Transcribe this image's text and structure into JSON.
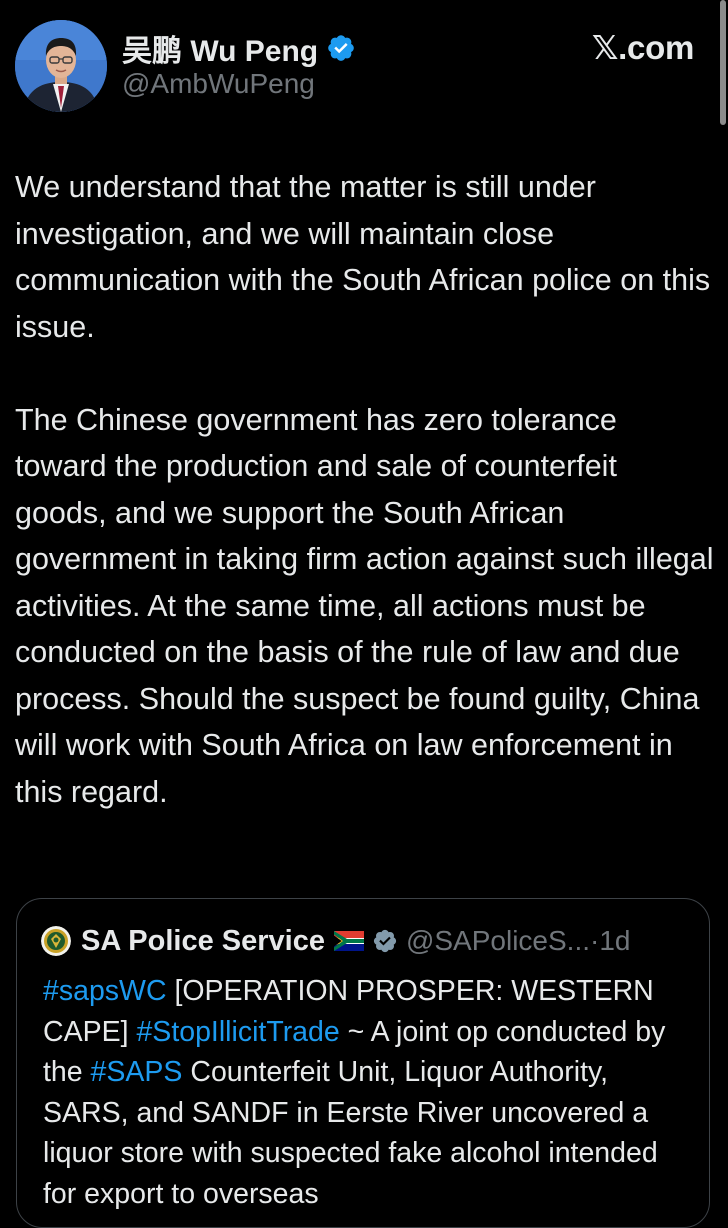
{
  "author": {
    "name": "吴鹏 Wu Peng",
    "handle": "@AmbWuPeng",
    "verified_color": "#1d9bf0"
  },
  "site_label": "𝕏.com",
  "icons": {
    "avatar": "profile-photo",
    "verified": "verified-badge-icon",
    "flag": "south-africa-flag-icon"
  },
  "tweet": {
    "paragraphs": [
      "We understand that the matter is still under investigation, and we will maintain close communication with the South African police on this issue.",
      "The Chinese government has zero tolerance toward the production and sale of counterfeit goods, and we support the South African government in taking firm action against such illegal activities. At the same time, all actions must be conducted on the basis of the rule of law and due process. Should the suspect be found guilty, China will work with South Africa on law enforcement in this regard."
    ]
  },
  "quote": {
    "name": "SA Police Service",
    "handle": "@SAPoliceS...",
    "separator": "·",
    "time": "1d",
    "segments": [
      {
        "text": "#sapsWC",
        "hashtag": true
      },
      {
        "text": " [OPERATION PROSPER: WESTERN CAPE] ",
        "hashtag": false
      },
      {
        "text": "#StopIllicitTrade",
        "hashtag": true
      },
      {
        "text": " ~ A joint op conducted by the ",
        "hashtag": false
      },
      {
        "text": "#SAPS",
        "hashtag": true
      },
      {
        "text": " Counterfeit Unit, Liquor Authority, SARS, and SANDF in Eerste River uncovered a liquor store with suspected fake alcohol intended for export to overseas",
        "hashtag": false
      }
    ]
  },
  "colors": {
    "background": "#000000",
    "text": "#e7e9ea",
    "muted": "#71767b",
    "link": "#1d9bf0",
    "border": "#3d4247"
  }
}
